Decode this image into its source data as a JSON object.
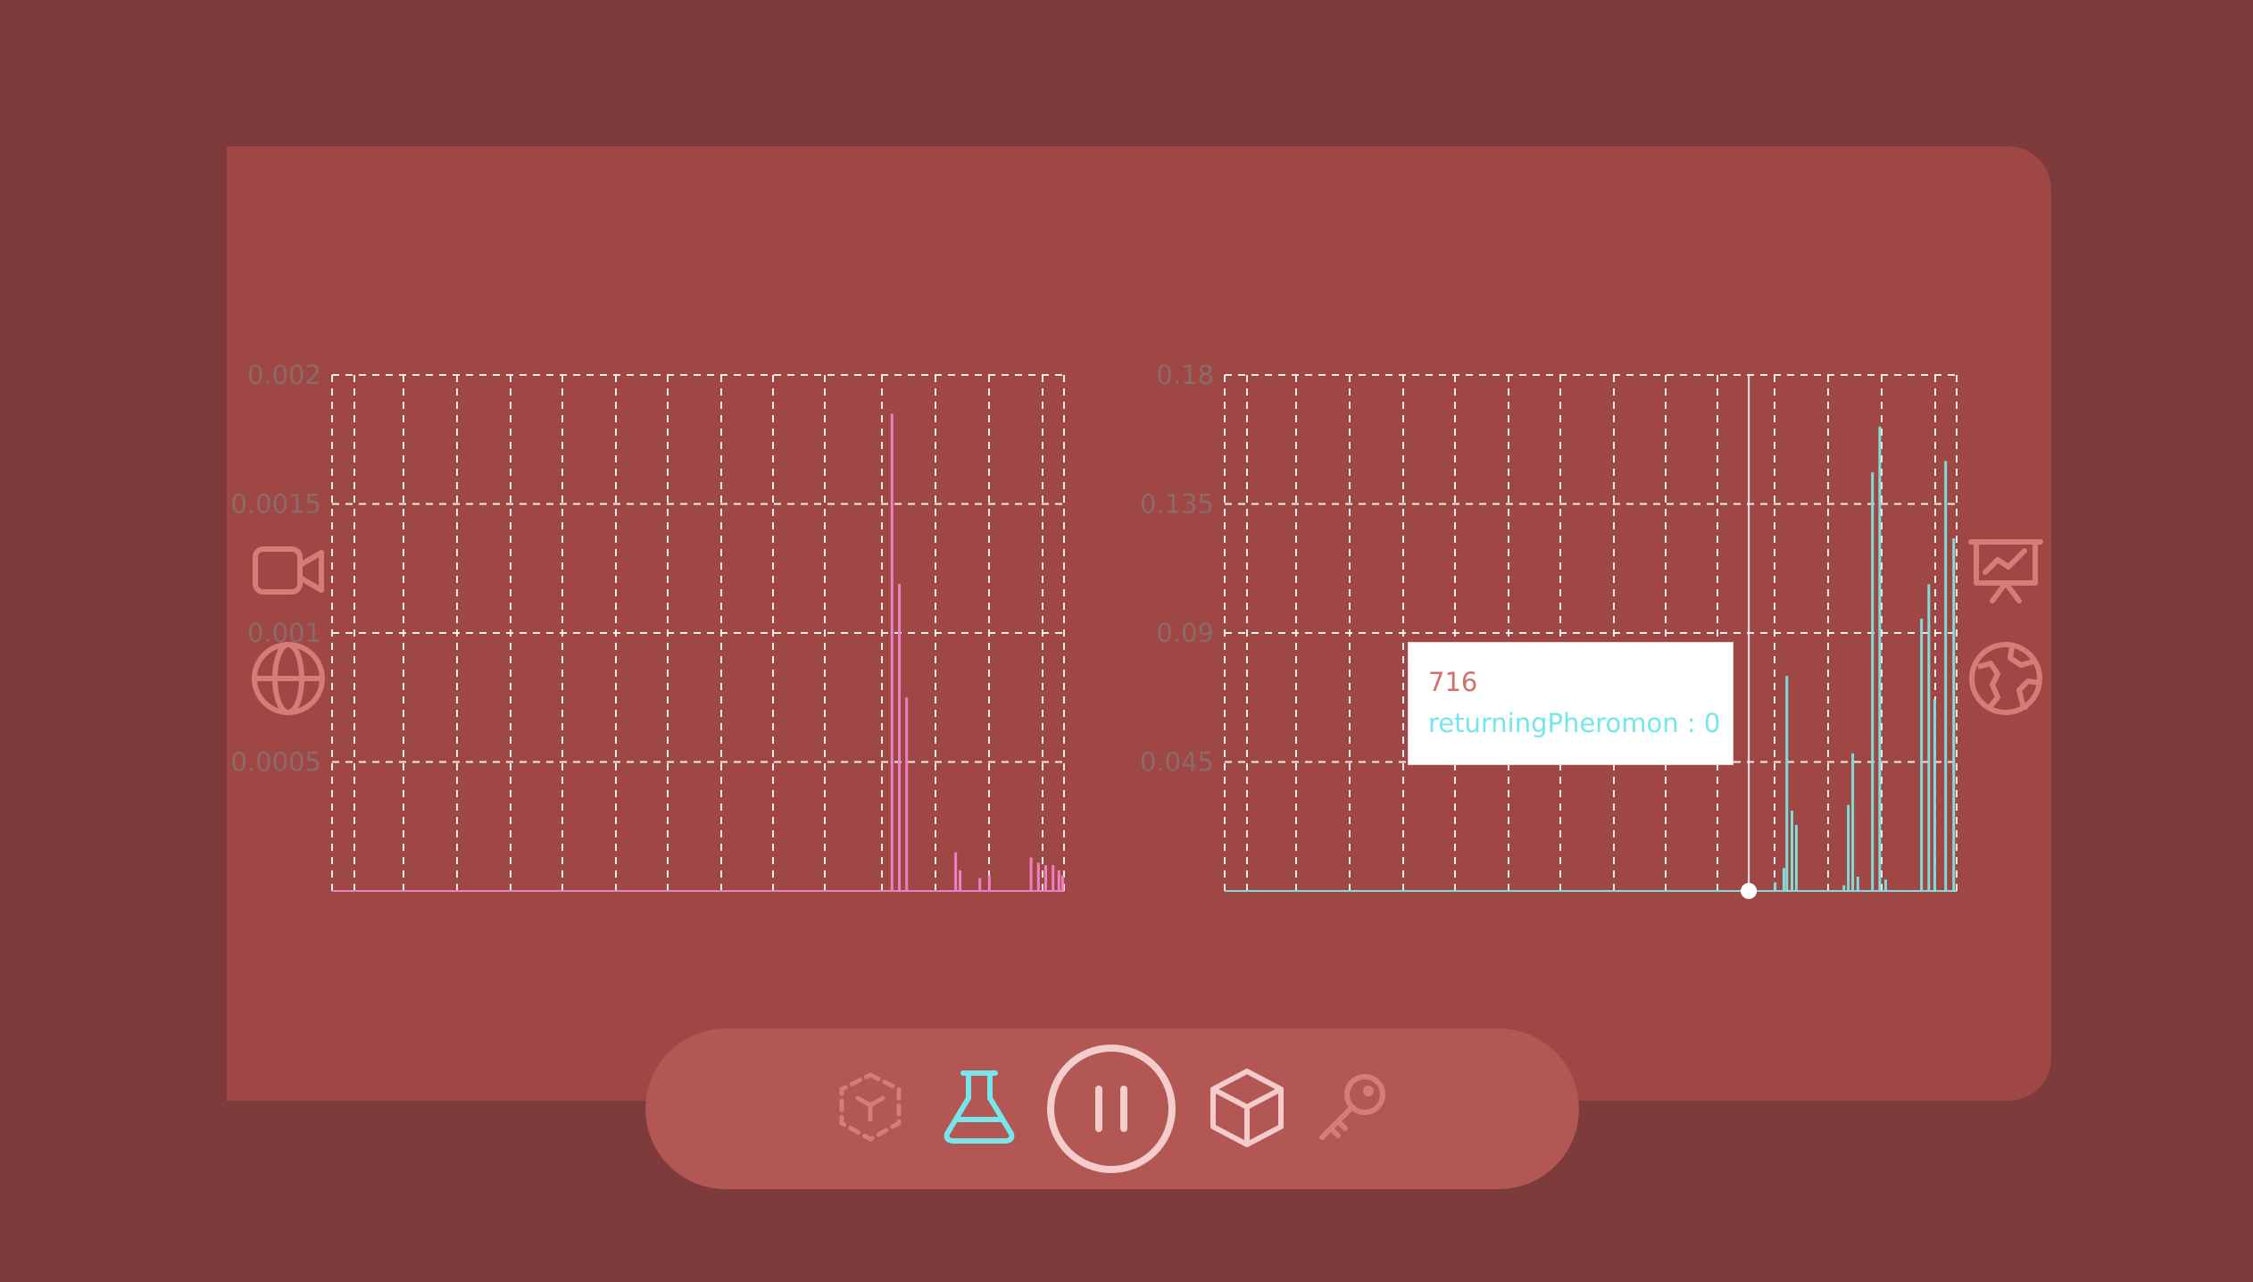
{
  "colors": {
    "background": "#7d3b3c",
    "panel": "#9e4745",
    "toolbar": "#b35754",
    "left_series": "#ee80c2",
    "right_series": "#7fdcd9",
    "icon_muted": "#d67c78",
    "icon_active": "#76e6ea",
    "icon_light": "#f3cccb"
  },
  "icons": {
    "left_top": "video-camera-icon",
    "left_bottom": "globe-icon",
    "right_top": "presentation-chart-icon",
    "right_bottom": "earth-icon"
  },
  "toolbar": {
    "items": [
      {
        "name": "ar-cube-icon",
        "state": "disabled"
      },
      {
        "name": "flask-icon",
        "state": "active"
      },
      {
        "name": "pause-icon",
        "state": "primary"
      },
      {
        "name": "box-icon",
        "state": "normal"
      },
      {
        "name": "key-icon",
        "state": "muted"
      }
    ]
  },
  "tooltip": {
    "title": "716",
    "series_label": "returningPheromon : 0"
  },
  "chart_data": [
    {
      "type": "bar",
      "ylim": [
        0,
        0.002
      ],
      "yticks": [
        "0.002",
        "0.0015",
        "0.001",
        "0.0005"
      ],
      "grid": true,
      "x_range": [
        0,
        1000
      ],
      "series": [
        {
          "color": "#ee80c2",
          "points": [
            [
              765,
              0.00185
            ],
            [
              775,
              0.00119
            ],
            [
              785,
              0.00075
            ],
            [
              852,
              0.00015
            ],
            [
              858,
              8e-05
            ],
            [
              885,
              5e-05
            ],
            [
              898,
              6e-05
            ],
            [
              955,
              0.00013
            ],
            [
              965,
              0.00011
            ],
            [
              975,
              0.0001
            ],
            [
              985,
              0.0001
            ],
            [
              993,
              8e-05
            ],
            [
              998,
              6e-05
            ]
          ]
        }
      ]
    },
    {
      "type": "bar",
      "ylim": [
        0,
        0.18
      ],
      "yticks": [
        "0.18",
        "0.135",
        "0.09",
        "0.045"
      ],
      "grid": true,
      "x_range": [
        0,
        1000
      ],
      "hover_x": 716,
      "series": [
        {
          "name": "returningPheromon",
          "color": "#7fdcd9",
          "points": [
            [
              752,
              0.003
            ],
            [
              764,
              0.008
            ],
            [
              768,
              0.075
            ],
            [
              775,
              0.028
            ],
            [
              781,
              0.023
            ],
            [
              846,
              0.002
            ],
            [
              852,
              0.03
            ],
            [
              858,
              0.048
            ],
            [
              865,
              0.005
            ],
            [
              885,
              0.146
            ],
            [
              895,
              0.162
            ],
            [
              903,
              0.004
            ],
            [
              952,
              0.095
            ],
            [
              962,
              0.107
            ],
            [
              970,
              0.067
            ],
            [
              985,
              0.15
            ],
            [
              996,
              0.123
            ]
          ]
        }
      ]
    }
  ]
}
